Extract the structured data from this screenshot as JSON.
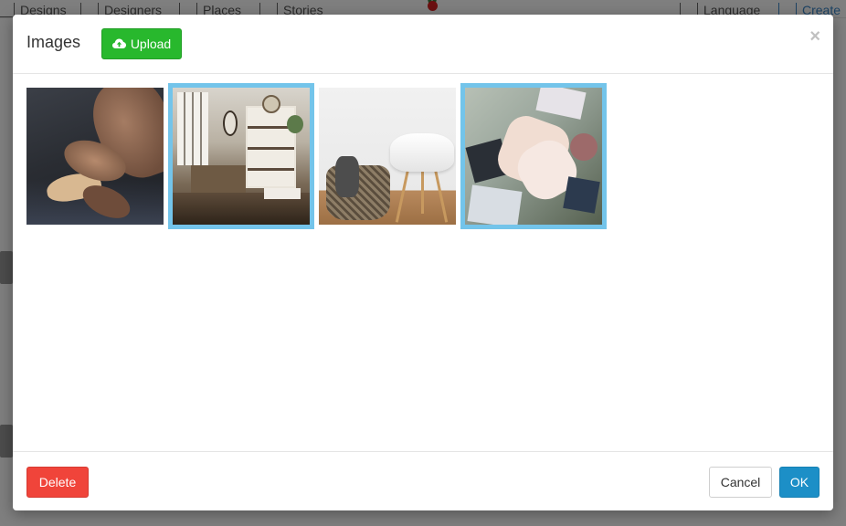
{
  "background": {
    "nav": {
      "items": [
        {
          "label": "Designs",
          "icon": "designs-icon"
        },
        {
          "label": "Designers",
          "icon": "designers-icon"
        },
        {
          "label": "Places",
          "icon": "map-pin-icon"
        },
        {
          "label": "Stories",
          "icon": "stories-icon"
        }
      ],
      "language_label": "Language",
      "create_label": "Create"
    }
  },
  "modal": {
    "title": "Images",
    "upload_label": "Upload",
    "close_glyph": "×",
    "images": [
      {
        "id": "img1",
        "selected": false
      },
      {
        "id": "img2",
        "selected": true
      },
      {
        "id": "img3",
        "selected": false
      },
      {
        "id": "img4",
        "selected": true
      }
    ],
    "footer": {
      "delete_label": "Delete",
      "cancel_label": "Cancel",
      "ok_label": "OK"
    }
  },
  "colors": {
    "upload_green": "#28b82d",
    "delete_red": "#f0443a",
    "ok_blue": "#1c8fc7",
    "selected_border": "#73c4ea"
  }
}
